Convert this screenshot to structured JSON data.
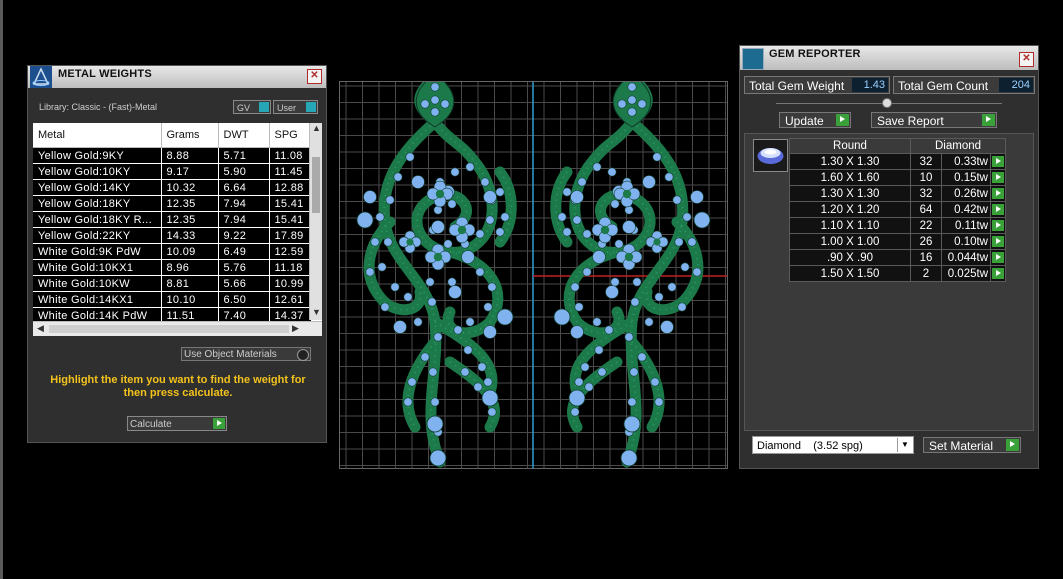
{
  "metal_panel": {
    "title": "METAL WEIGHTS",
    "library": "Library: Classic - (Fast)-Metal",
    "gv_label": "GV",
    "user_label": "User",
    "columns": [
      "Metal",
      "Grams",
      "DWT",
      "SPG"
    ],
    "rows": [
      [
        "Yellow Gold:9KY",
        "8.88",
        "5.71",
        "11.08"
      ],
      [
        "Yellow Gold:10KY",
        "9.17",
        "5.90",
        "11.45"
      ],
      [
        "Yellow Gold:14KY",
        "10.32",
        "6.64",
        "12.88"
      ],
      [
        "Yellow Gold:18KY",
        "12.35",
        "7.94",
        "15.41"
      ],
      [
        "Yellow Gold:18KY R...",
        "12.35",
        "7.94",
        "15.41"
      ],
      [
        "Yellow Gold:22KY",
        "14.33",
        "9.22",
        "17.89"
      ],
      [
        "White Gold:9K PdW",
        "10.09",
        "6.49",
        "12.59"
      ],
      [
        "White Gold:10KX1",
        "8.96",
        "5.76",
        "11.18"
      ],
      [
        "White Gold:10KW",
        "8.81",
        "5.66",
        "10.99"
      ],
      [
        "White Gold:14KX1",
        "10.10",
        "6.50",
        "12.61"
      ],
      [
        "White Gold:14K PdW",
        "11.51",
        "7.40",
        "14.37"
      ]
    ],
    "use_object_materials": "Use Object Materials",
    "hint": "Highlight the item you want to find the weight for then press calculate.",
    "calculate_label": "Calculate"
  },
  "gem_panel": {
    "title": "GEM REPORTER",
    "total_weight_label": "Total Gem Weight",
    "total_weight": "1.43",
    "total_count_label": "Total Gem Count",
    "total_count": "204",
    "update_label": "Update",
    "save_label": "Save Report",
    "shape_header": "Round",
    "material_header": "Diamond",
    "gems": [
      [
        "1.30 X 1.30",
        "32",
        "0.33tw"
      ],
      [
        "1.60 X 1.60",
        "10",
        "0.15tw"
      ],
      [
        "1.30 X 1.30",
        "32",
        "0.26tw"
      ],
      [
        "1.20 X 1.20",
        "64",
        "0.42tw"
      ],
      [
        "1.10 X 1.10",
        "22",
        "0.11tw"
      ],
      [
        "1.00 X 1.00",
        "26",
        "0.10tw"
      ],
      [
        ".90 X .90",
        "16",
        "0.044tw"
      ],
      [
        "1.50 X 1.50",
        "2",
        "0.025tw"
      ]
    ],
    "material_select": "Diamond    (3.52 spg)",
    "set_material_label": "Set Material"
  },
  "colors": {
    "grid": "#4a4a4a",
    "metal_green": "#1c7a4a",
    "gem_blue": "#7fb2ee",
    "axis_blue": "#2a9fd6",
    "axis_red": "#c02020"
  }
}
